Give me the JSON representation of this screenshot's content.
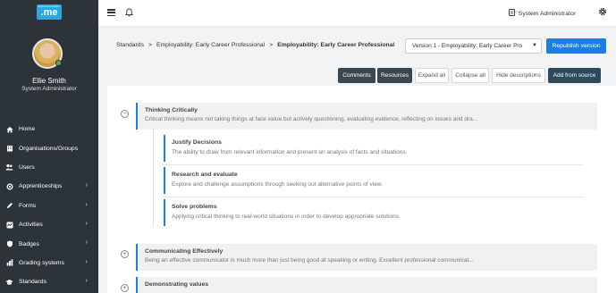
{
  "logo": {
    "small": "apprenticeships",
    "big": ".me"
  },
  "user": {
    "name": "Ellie Smith",
    "role": "System Administrator"
  },
  "sidebar": {
    "items": [
      {
        "label": "Home",
        "icon": "home-icon",
        "chevron": ""
      },
      {
        "label": "Organisations/Groups",
        "icon": "building-icon",
        "chevron": ""
      },
      {
        "label": "Users",
        "icon": "users-icon",
        "chevron": ""
      },
      {
        "label": "Apprenticeships",
        "icon": "target-icon",
        "chevron": "›"
      },
      {
        "label": "Forms",
        "icon": "pencil-icon",
        "chevron": "›"
      },
      {
        "label": "Activities",
        "icon": "activities-icon",
        "chevron": "›"
      },
      {
        "label": "Badges",
        "icon": "shield-icon",
        "chevron": "›"
      },
      {
        "label": "Grading systems",
        "icon": "chart-icon",
        "chevron": "›"
      },
      {
        "label": "Standards",
        "icon": "graduation-cap-icon",
        "chevron": "›"
      }
    ]
  },
  "topbar": {
    "user_label": "System Administrator"
  },
  "breadcrumb": {
    "items": [
      "Standards",
      "Employability: Early Career Professional"
    ],
    "separator": ">",
    "current": "Employability: Early Career Professional"
  },
  "version_select": {
    "value": "Version 1 - Employability: Early Career Pro"
  },
  "buttons": {
    "republish": "Republish version",
    "comments": "Comments",
    "resources": "Resources",
    "expand_all": "Expand all",
    "collapse_all": "Collapse all",
    "hide_descriptions": "Hide descriptions",
    "add_from_source": "Add from source"
  },
  "sections": [
    {
      "title": "Thinking Critically",
      "description": "Critical thinking means not taking things at face value but actively questioning, evaluating evidence, reflecting on issues and dra...",
      "toggle": "−",
      "children": [
        {
          "title": "Justify Decisions",
          "description": "The ability to draw from relevant information and present an analysis of facts and situations."
        },
        {
          "title": "Research and evaluate",
          "description": "Explore and challenge assumptions through seeking out alternative points of view."
        },
        {
          "title": "Solve problems",
          "description": "Applying critical thinking to real-world situations in order to develop appropriate solutions."
        }
      ]
    },
    {
      "title": "Communicating Effectively",
      "description": "Being an effective communicator is much more than just being good at speaking or writing. Excellent professional communicat...",
      "toggle": "+"
    },
    {
      "title": "Demonstrating values",
      "description": "",
      "toggle": "+"
    }
  ],
  "colors": {
    "accent": "#1a7ee8",
    "sidebar": "#2c3339",
    "logo": "#29a8e0"
  }
}
